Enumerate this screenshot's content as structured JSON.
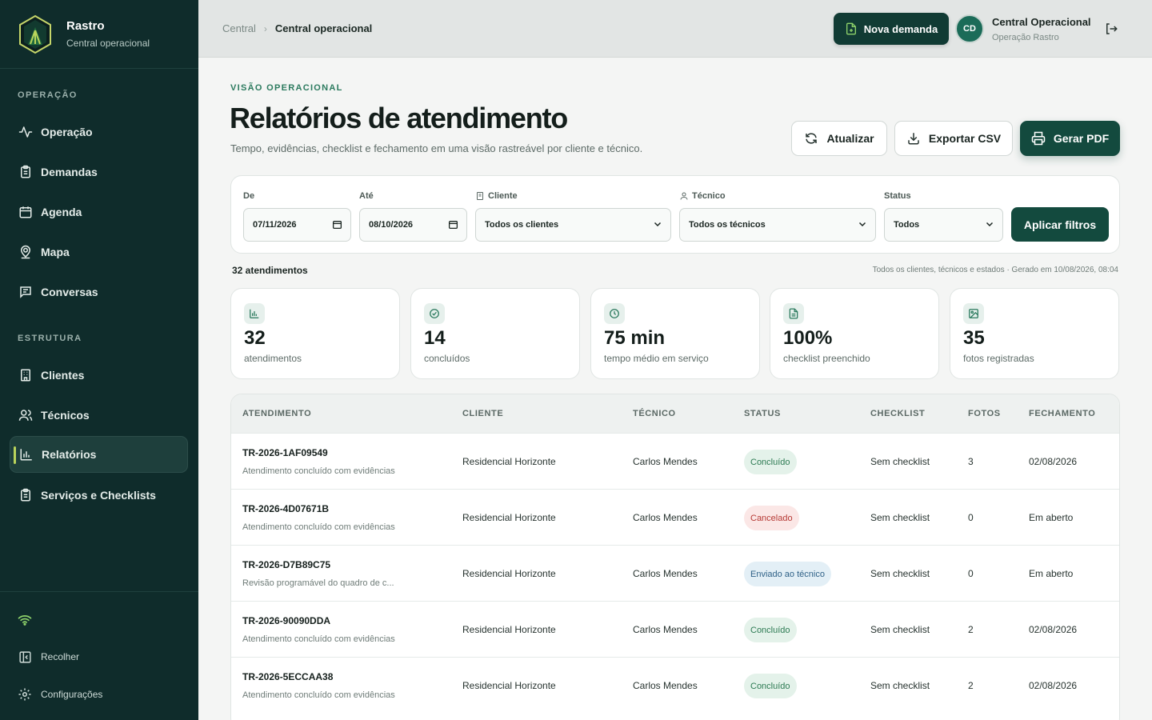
{
  "brand": {
    "name": "Rastro",
    "subtitle": "Central operacional"
  },
  "sidebar": {
    "sections": [
      "OPERAÇÃO",
      "ESTRUTURA"
    ],
    "items": [
      {
        "label": "Operação",
        "icon": "activity-icon"
      },
      {
        "label": "Demandas",
        "icon": "clipboard-icon"
      },
      {
        "label": "Agenda",
        "icon": "calendar-icon"
      },
      {
        "label": "Mapa",
        "icon": "map-pin-icon"
      },
      {
        "label": "Conversas",
        "icon": "chat-icon"
      },
      {
        "label": "Clientes",
        "icon": "building-icon"
      },
      {
        "label": "Técnicos",
        "icon": "users-icon"
      },
      {
        "label": "Relatórios",
        "icon": "bar-chart-icon",
        "active": true
      },
      {
        "label": "Serviços e Checklists",
        "icon": "clipboard-check-icon"
      }
    ],
    "footer": {
      "collapse": "Recolher",
      "settings": "Configurações"
    }
  },
  "topbar": {
    "breadcrumb": [
      "Central",
      "Central operacional"
    ],
    "new_button": "Nova demanda",
    "user": {
      "initials": "CD",
      "name": "Central Operacional",
      "role": "Operação Rastro"
    }
  },
  "page": {
    "eyebrow": "VISÃO OPERACIONAL",
    "title": "Relatórios de atendimento",
    "subtitle": "Tempo, evidências, checklist e fechamento em uma visão rastreável por cliente e técnico.",
    "actions": {
      "refresh": "Atualizar",
      "export": "Exportar CSV",
      "pdf": "Gerar PDF"
    }
  },
  "filters": {
    "from": {
      "label": "De",
      "value": "07/11/2026"
    },
    "to": {
      "label": "Até",
      "value": "08/10/2026"
    },
    "client": {
      "label": "Cliente",
      "value": "Todos os clientes"
    },
    "tech": {
      "label": "Técnico",
      "value": "Todos os técnicos"
    },
    "status": {
      "label": "Status",
      "value": "Todos"
    },
    "apply": "Aplicar filtros"
  },
  "summary": {
    "count": "32 atendimentos",
    "generated": "Todos os clientes, técnicos e estados · Gerado em 10/08/2026, 08:04"
  },
  "kpis": [
    {
      "value": "32",
      "label": "atendimentos",
      "icon": "bar-chart-icon"
    },
    {
      "value": "14",
      "label": "concluídos",
      "icon": "check-circle-icon"
    },
    {
      "value": "75 min",
      "label": "tempo médio em serviço",
      "icon": "clock-icon"
    },
    {
      "value": "100%",
      "label": "checklist preenchido",
      "icon": "document-icon"
    },
    {
      "value": "35",
      "label": "fotos registradas",
      "icon": "image-icon"
    }
  ],
  "table": {
    "headers": [
      "ATENDIMENTO",
      "CLIENTE",
      "TÉCNICO",
      "STATUS",
      "CHECKLIST",
      "FOTOS",
      "FECHAMENTO"
    ],
    "rows": [
      {
        "id": "TR-2026-1AF09549",
        "desc": "Atendimento concluído com evidências",
        "client": "Residencial Horizonte",
        "tech": "Carlos Mendes",
        "status": "Concluído",
        "checklist": "Sem checklist",
        "photos": "3",
        "closing": "02/08/2026"
      },
      {
        "id": "TR-2026-4D07671B",
        "desc": "Atendimento concluído com evidências",
        "client": "Residencial Horizonte",
        "tech": "Carlos Mendes",
        "status": "Cancelado",
        "checklist": "Sem checklist",
        "photos": "0",
        "closing": "Em aberto"
      },
      {
        "id": "TR-2026-D7B89C75",
        "desc": "Revisão programável do quadro de c...",
        "client": "Residencial Horizonte",
        "tech": "Carlos Mendes",
        "status": "Enviado ao técnico",
        "checklist": "Sem checklist",
        "photos": "0",
        "closing": "Em aberto"
      },
      {
        "id": "TR-2026-90090DDA",
        "desc": "Atendimento concluído com evidências",
        "client": "Residencial Horizonte",
        "tech": "Carlos Mendes",
        "status": "Concluído",
        "checklist": "Sem checklist",
        "photos": "2",
        "closing": "02/08/2026"
      },
      {
        "id": "TR-2026-5ECCAA38",
        "desc": "Atendimento concluído com evidências",
        "client": "Residencial Horizonte",
        "tech": "Carlos Mendes",
        "status": "Concluído",
        "checklist": "Sem checklist",
        "photos": "2",
        "closing": "02/08/2026"
      }
    ]
  },
  "colors": {
    "sidebar": "#0f2c2b",
    "primary": "#134a3e",
    "accent": "#b9d35b",
    "ok": "#2c7a52",
    "cancel": "#b63a35",
    "sent": "#2f6187"
  }
}
